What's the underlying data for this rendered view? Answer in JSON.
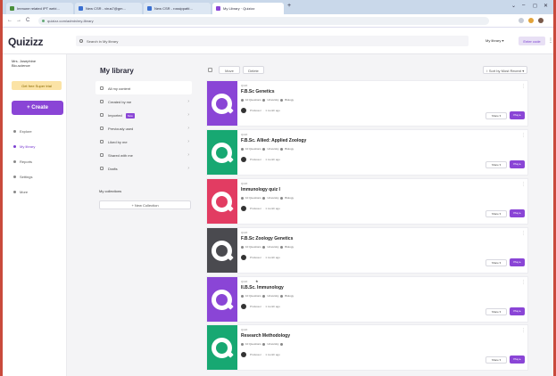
{
  "browser": {
    "tabs": [
      {
        "label": "Immune related IPT webi…",
        "color": "#4a8f3b"
      },
      {
        "label": "New CSR - virus7@gm…",
        "color": "#3a6fd1"
      },
      {
        "label": "New CSR - rossippatti…",
        "color": "#3a6fd1"
      },
      {
        "label": "My Library · Quizizz",
        "color": "#8a45d6"
      }
    ],
    "new_tab": "+",
    "window_controls": [
      "⌄",
      "–",
      "◻",
      "✕"
    ],
    "nav": [
      "←",
      "→",
      "C"
    ],
    "url": "quizizz.com/admin/my-library"
  },
  "app": {
    "logo": "Quizizz",
    "search_placeholder": "Search in My library",
    "mylib_dropdown": "My library ▾",
    "enter_code": "Enter code",
    "more": "⋮"
  },
  "sidebar": {
    "user_name": "Mrs. Josephine",
    "user_sub": "Bio-science",
    "upgrade": "Get free Super trial",
    "create": "+ Create",
    "items": [
      {
        "label": "Explore",
        "active": false
      },
      {
        "label": "My library",
        "active": true
      },
      {
        "label": "Reports",
        "active": false
      },
      {
        "label": "Settings",
        "active": false
      },
      {
        "label": "More",
        "active": false
      }
    ]
  },
  "library": {
    "title": "My library",
    "menu": [
      {
        "label": "All my content",
        "active": true,
        "badge": ""
      },
      {
        "label": "Created by me",
        "active": false,
        "badge": ""
      },
      {
        "label": "Imported",
        "active": false,
        "badge": "New"
      },
      {
        "label": "Previously used",
        "active": false,
        "badge": ""
      },
      {
        "label": "Liked by me",
        "active": false,
        "badge": ""
      },
      {
        "label": "Shared with me",
        "active": false,
        "badge": ""
      },
      {
        "label": "Drafts",
        "active": false,
        "badge": ""
      }
    ],
    "collections_heading": "My collections",
    "new_collection": "+ New Collection",
    "toolbar": {
      "filter_1": "Move",
      "filter_2": "Delete",
      "sort": "↕ Sort by Most Recent ▾"
    }
  },
  "quizzes": [
    {
      "kind": "QUIZ",
      "title": "F.B.Sc Genetics",
      "questions": "10 Questions",
      "level": "University",
      "subject": "Biology",
      "owner": "Professor",
      "age": "1 month ago",
      "thumb_color": "#8a45d6",
      "starred": false
    },
    {
      "kind": "QUIZ",
      "title": "F.B.Sc. Allied: Applied Zoology",
      "questions": "10 Questions",
      "level": "University",
      "subject": "Biology",
      "owner": "Professor",
      "age": "1 month ago",
      "thumb_color": "#17a872",
      "starred": false
    },
    {
      "kind": "QUIZ",
      "title": "Immunology quiz I",
      "questions": "10 Questions",
      "level": "University",
      "subject": "Biology",
      "owner": "Professor",
      "age": "1 month ago",
      "thumb_color": "#e23c62",
      "starred": false
    },
    {
      "kind": "QUIZ",
      "title": "F.B.Sc Zoology Genetics",
      "questions": "10 Questions",
      "level": "University",
      "subject": "Biology",
      "owner": "Professor",
      "age": "1 month ago",
      "thumb_color": "#4a4a4f",
      "starred": false
    },
    {
      "kind": "QUIZ",
      "title": "II.B.Sc. Immunology",
      "questions": "10 Questions",
      "level": "University",
      "subject": "Biology",
      "owner": "Professor",
      "age": "1 month ago",
      "thumb_color": "#8a45d6",
      "starred": true
    },
    {
      "kind": "QUIZ",
      "title": "Research Methodology",
      "questions": "10 Questions",
      "level": "University",
      "subject": "",
      "owner": "Professor",
      "age": "1 month ago",
      "thumb_color": "#17a872",
      "starred": false
    }
  ],
  "card_actions": {
    "share": "Share ▾",
    "play": "Play ▸",
    "more": "⋮"
  }
}
